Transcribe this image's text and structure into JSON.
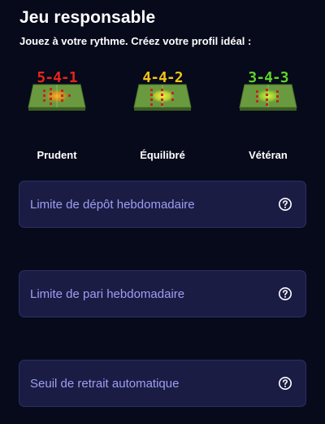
{
  "header": {
    "title": "Jeu responsable",
    "subtitle": "Jouez à votre rythme. Créez votre profil idéal :"
  },
  "profiles": [
    {
      "formation": "5-4-1",
      "label": "Prudent",
      "color": "#e8251b"
    },
    {
      "formation": "4-4-2",
      "label": "Équilibré",
      "color": "#f0c419"
    },
    {
      "formation": "3-4-3",
      "label": "Vétéran",
      "color": "#5fd32c"
    }
  ],
  "limits": [
    {
      "label": "Limite de dépôt hebdomadaire",
      "icon": "question-circle-icon"
    },
    {
      "label": "Limite de pari hebdomadaire",
      "icon": "question-circle-icon"
    },
    {
      "label": "Seuil de retrait automatique",
      "icon": "question-circle-icon"
    }
  ],
  "colors": {
    "background": "#070a1b",
    "card": "#1b1c44",
    "card_border": "#2c2e62",
    "card_text": "#9d9ff0"
  }
}
